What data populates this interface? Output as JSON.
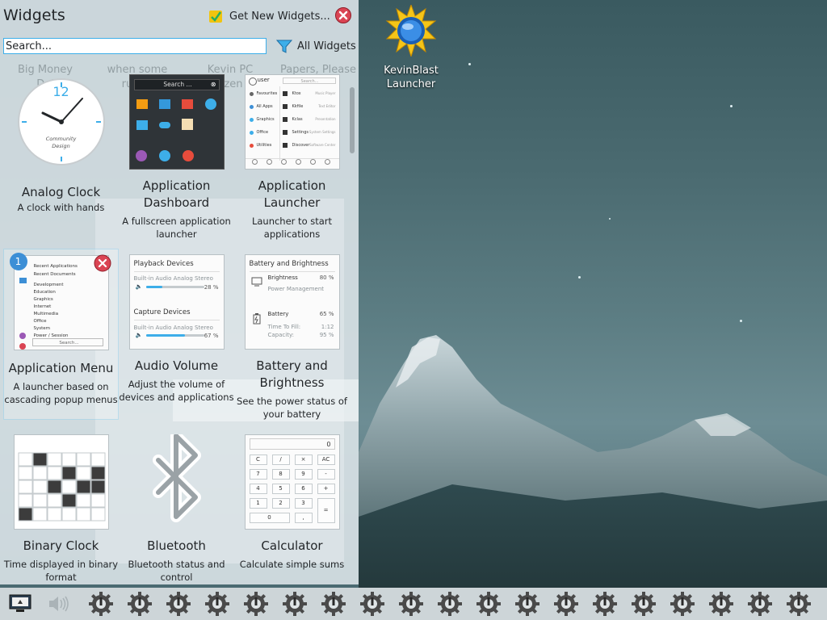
{
  "panel": {
    "title": "Widgets",
    "get_new_label": "Get New Widgets...",
    "search_placeholder": "Search...",
    "filter_label": "All Widgets",
    "ghost_labels": [
      "Big Money Del",
      "when some russia",
      "Kevin PC ozen",
      "Papers, Please"
    ]
  },
  "desktop": {
    "icon_label_1": "KevinBlast",
    "icon_label_2": "Launcher"
  },
  "widgets": [
    {
      "name": "Analog Clock",
      "desc": "A clock with hands"
    },
    {
      "name": "Application Dashboard",
      "desc": "A fullscreen application launcher"
    },
    {
      "name": "Application Launcher",
      "desc": "Launcher to start applications"
    },
    {
      "name": "Application Menu",
      "desc": "A launcher based on cascading popup menus"
    },
    {
      "name": "Audio Volume",
      "desc": "Adjust the volume of devices and applications"
    },
    {
      "name": "Battery and Brightness",
      "desc": "See the power status of your battery"
    },
    {
      "name": "Binary Clock",
      "desc": "Time displayed in binary format"
    },
    {
      "name": "Bluetooth",
      "desc": "Bluetooth status and control"
    },
    {
      "name": "Calculator",
      "desc": "Calculate simple sums"
    }
  ],
  "thumbs": {
    "clock": {
      "twelve": "12",
      "brand_1": "Community",
      "brand_2": "Design"
    },
    "dashboard": {
      "search": "Search ..."
    },
    "launcher": {
      "user": "user",
      "search": "Search...",
      "left": [
        "Favourites",
        "All Apps",
        "Graphics",
        "Office",
        "Utilities"
      ],
      "right": [
        "Ktox",
        "Kkfile",
        "Kclas",
        "Settings",
        "Discover"
      ],
      "right_sub": [
        "Music Player",
        "Text Editor",
        "Presentation",
        "System Settings",
        "Software Center"
      ]
    },
    "menu": {
      "badge": "1",
      "items": [
        "Recent Applications",
        "Recent Documents",
        "Development",
        "Education",
        "Graphics",
        "Internet",
        "Multimedia",
        "Office",
        "System",
        "Power / Session"
      ],
      "search": "Search..."
    },
    "audio": {
      "playback": "Playback Devices",
      "out": "Built-in Audio Analog Stereo",
      "out_pct": "28 %",
      "out_level": 0.28,
      "capture": "Capture Devices",
      "in": "Built-in Audio Analog Stereo",
      "in_pct": "67 %",
      "in_level": 0.67
    },
    "battery": {
      "head": "Battery and Brightness",
      "brightness": "Brightness",
      "brightness_pct": "80 %",
      "power": "Power Management",
      "battery": "Battery",
      "battery_pct": "65 %",
      "ttf": "Time To Fill:",
      "ttf_val": "1:12",
      "cap": "Capacity:",
      "cap_val": "95 %"
    },
    "calc": {
      "display": "0",
      "keys": [
        "C",
        "/",
        "×",
        "AC",
        "7",
        "8",
        "9",
        "-",
        "4",
        "5",
        "6",
        "+",
        "1",
        "2",
        "3",
        "=",
        "0",
        ","
      ]
    }
  },
  "colors": {
    "accent": "#3daee9",
    "close": "#da4453"
  }
}
